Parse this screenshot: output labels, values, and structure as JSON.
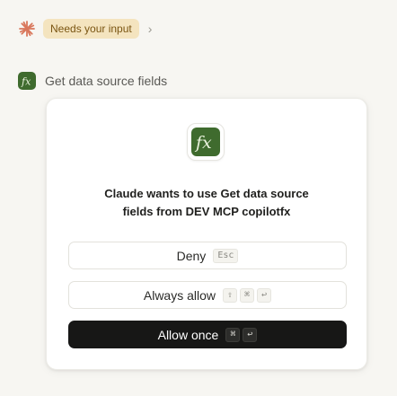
{
  "status": {
    "badge_text": "Needs your input",
    "spark_icon": "claude-spark-icon",
    "spark_color": "#d9775b",
    "badge_bg": "#f4e4bf",
    "chevron_glyph": "›"
  },
  "tool": {
    "name": "Get data source fields",
    "icon": "function-fx-icon",
    "icon_glyph": "fx",
    "icon_color": "#3f6b2e"
  },
  "card": {
    "title_line1": "Claude wants to use Get data source",
    "title_line2": "fields from DEV MCP copilotfx",
    "deny": {
      "label": "Deny",
      "shortcut": "Esc"
    },
    "always_allow": {
      "label": "Always allow",
      "shortcut_keys": [
        "⇧",
        "⌘",
        "↩"
      ]
    },
    "allow_once": {
      "label": "Allow once",
      "shortcut_keys": [
        "⌘",
        "↩"
      ]
    }
  }
}
